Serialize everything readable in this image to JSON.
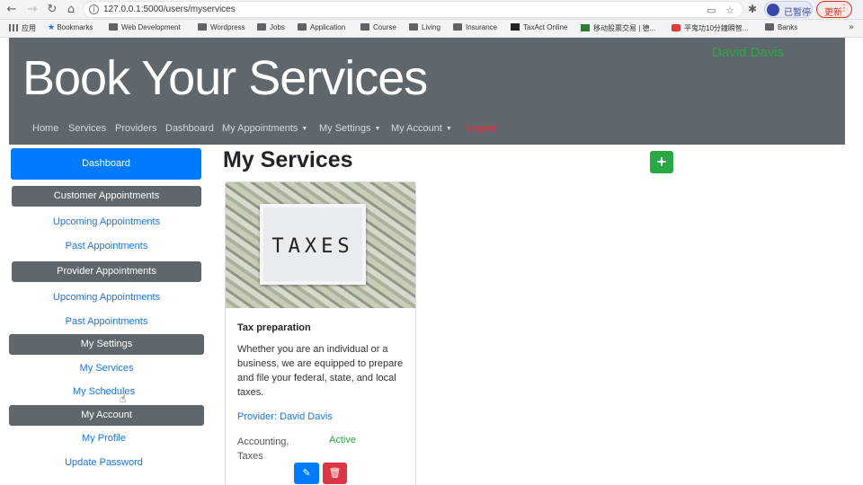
{
  "browser": {
    "url": "127.0.0.1:5000/users/myservices",
    "profile_label": "已暂停",
    "update_label": "更新"
  },
  "bookmarks": [
    {
      "label": "应用",
      "icon": "apps-icon"
    },
    {
      "label": "Bookmarks",
      "icon": "star-icon"
    },
    {
      "label": "Web Development",
      "icon": "folder-icon"
    },
    {
      "label": "Wordpress",
      "icon": "folder-icon"
    },
    {
      "label": "Jobs",
      "icon": "folder-icon"
    },
    {
      "label": "Application",
      "icon": "folder-icon"
    },
    {
      "label": "Course",
      "icon": "folder-icon"
    },
    {
      "label": "Living",
      "icon": "folder-icon"
    },
    {
      "label": "Insurance",
      "icon": "folder-icon"
    },
    {
      "label": "TaxAct Online",
      "icon": "taxact-icon"
    },
    {
      "label": "移动股票交易 | 德...",
      "icon": "td-icon"
    },
    {
      "label": "平鬼功10分鐘瞬智...",
      "icon": "youtube-icon"
    },
    {
      "label": "Banks",
      "icon": "folder-icon"
    }
  ],
  "header": {
    "site_title": "Book Your Services",
    "user_name": "David Davis",
    "nav": {
      "home": "Home",
      "services": "Services",
      "providers": "Providers",
      "dashboard": "Dashboard",
      "my_appointments": "My Appointments",
      "my_settings": "My Settings",
      "my_account": "My Account",
      "logout": "Logout"
    }
  },
  "sidebar": {
    "dashboard": "Dashboard",
    "customer_appointments": "Customer Appointments",
    "customer_upcoming": "Upcoming Appointments",
    "customer_past": "Past Appointments",
    "provider_appointments": "Provider Appointments",
    "provider_upcoming": "Upcoming Appointments",
    "provider_past": "Past Appointments",
    "my_settings": "My Settings",
    "my_services": "My Services",
    "my_schedules": "My Schedules",
    "my_account": "My Account",
    "my_profile": "My Profile",
    "update_password": "Update Password"
  },
  "main": {
    "heading": "My Services",
    "add_label": "+",
    "service": {
      "image_text": "TAXES",
      "title": "Tax preparation",
      "description": "Whether you are an individual or a business, we are equipped to prepare and file your federal, state, and local taxes.",
      "provider": "Provider: David Davis",
      "category": "Accounting, Taxes",
      "status": "Active"
    }
  },
  "colors": {
    "header_bg": "#5f676c",
    "primary": "#007bff",
    "success": "#28a745",
    "danger": "#dc3545",
    "link": "#1a73e8"
  }
}
